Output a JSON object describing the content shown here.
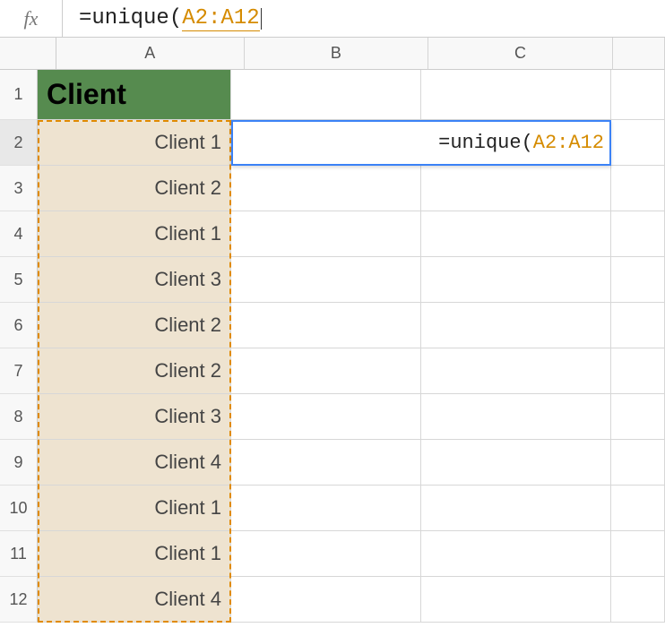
{
  "formula_bar": {
    "fx_label": "fx",
    "prefix": "=unique(",
    "range_ref": "A2:A12"
  },
  "columns": [
    "A",
    "B",
    "C"
  ],
  "rows": [
    "1",
    "2",
    "3",
    "4",
    "5",
    "6",
    "7",
    "8",
    "9",
    "10",
    "11",
    "12"
  ],
  "header_cell": "Client",
  "column_a_data": [
    "Client 1",
    "Client 2",
    "Client 1",
    "Client 3",
    "Client 2",
    "Client 2",
    "Client 3",
    "Client 4",
    "Client 1",
    "Client 1",
    "Client 4"
  ],
  "active_cell": {
    "prefix": "=unique(",
    "range_ref": "A2:A12"
  },
  "selection": {
    "highlighted_range": "A2:A12",
    "active_row": "2",
    "active_columns": [
      "B",
      "C"
    ]
  },
  "colors": {
    "header_bg": "#568b4f",
    "data_bg": "#eee3d0",
    "ants": "#e08a00",
    "active_border": "#3b82f6",
    "ref_color": "#d58b00"
  }
}
